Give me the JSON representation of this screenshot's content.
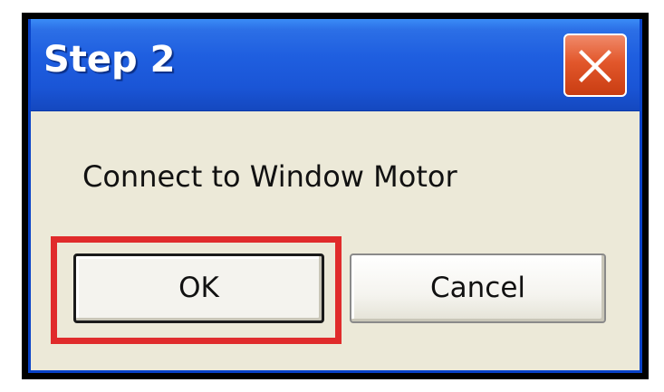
{
  "window": {
    "title": "Step 2",
    "close_icon": "close-x-icon"
  },
  "body": {
    "message": "Connect to Window Motor"
  },
  "buttons": {
    "ok_label": "OK",
    "cancel_label": "Cancel"
  },
  "annotation": {
    "highlight_target": "ok-button",
    "highlight_color": "#e02b2b"
  },
  "colors": {
    "titlebar": "#1f5fe0",
    "close_button": "#e2572b",
    "dialog_background": "#ece9d8"
  }
}
